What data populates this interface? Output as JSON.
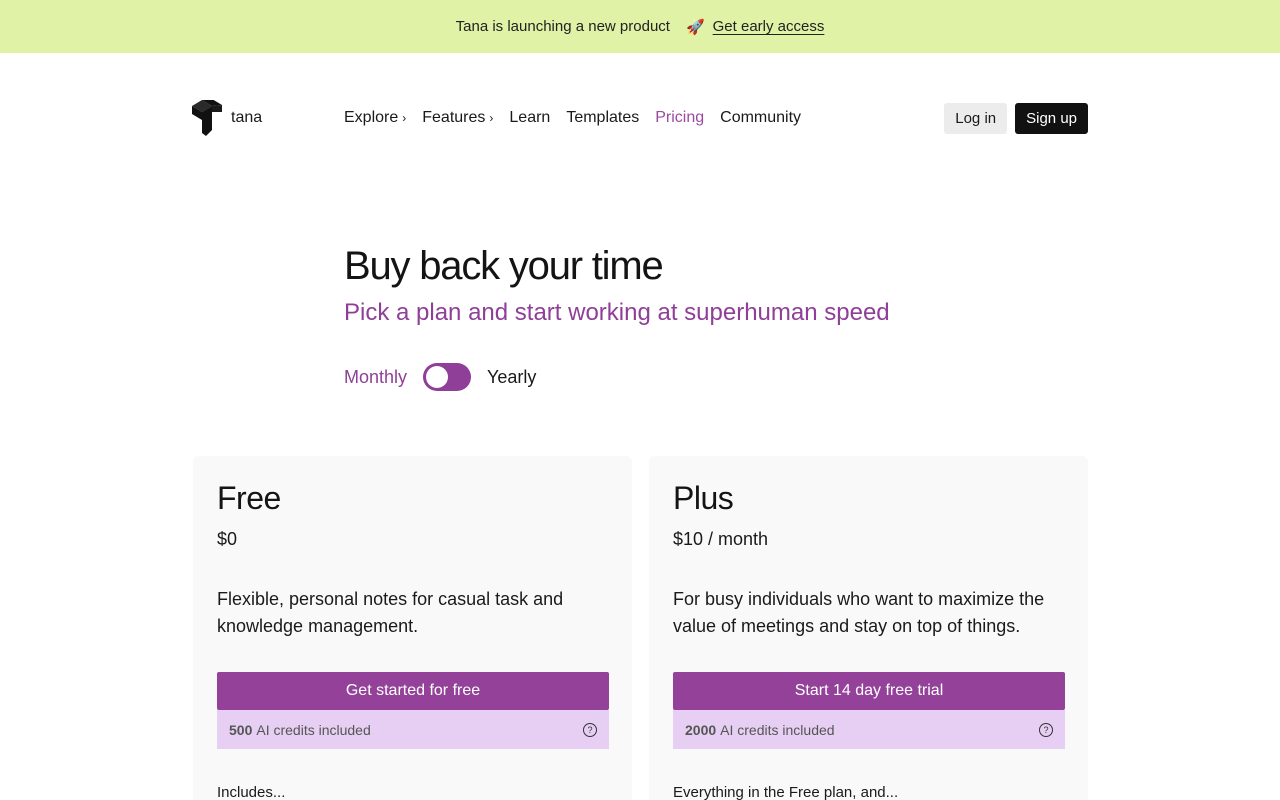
{
  "banner": {
    "text": "Tana is launching a new product",
    "rocket_icon": "🚀",
    "link": "Get early access"
  },
  "nav": {
    "logo_text": "tana",
    "items": [
      {
        "label": "Explore",
        "has_chevron": true
      },
      {
        "label": "Features",
        "has_chevron": true
      },
      {
        "label": "Learn"
      },
      {
        "label": "Templates"
      },
      {
        "label": "Pricing",
        "active": true
      },
      {
        "label": "Community"
      }
    ],
    "login": "Log in",
    "signup": "Sign up"
  },
  "hero": {
    "title": "Buy back your time",
    "subtitle": "Pick a plan and start working at superhuman speed"
  },
  "billing": {
    "monthly": "Monthly",
    "yearly": "Yearly",
    "selected": "Monthly"
  },
  "plans": [
    {
      "name": "Free",
      "price": "$0",
      "description": "Flexible, personal notes for casual task and knowledge management.",
      "cta": "Get started for free",
      "credits_amount": "500",
      "credits_text": "AI credits included",
      "includes": "Includes..."
    },
    {
      "name": "Plus",
      "price": "$10 / month",
      "description": "For busy individuals who want to maximize the value of meetings and stay on top of things.",
      "cta": "Start 14 day free trial",
      "credits_amount": "2000",
      "credits_text": "AI credits included",
      "includes": "Everything in the Free plan, and..."
    }
  ],
  "colors": {
    "banner_bg": "#dff2a6",
    "accent": "#944299",
    "credits_bg": "#e7cff3"
  }
}
